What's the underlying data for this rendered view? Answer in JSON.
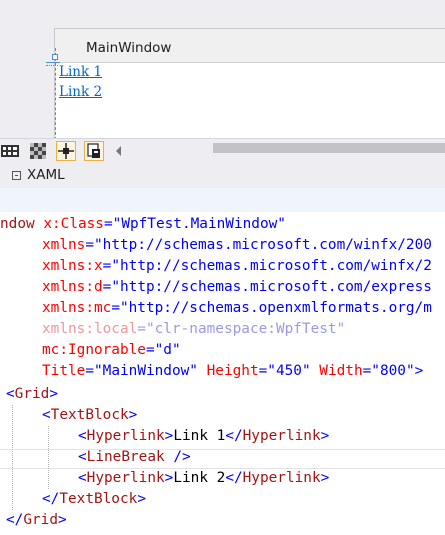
{
  "designer": {
    "window_title": "MainWindow",
    "links": [
      "Link 1",
      "Link 2"
    ]
  },
  "toolbar": {
    "icons": [
      "grid-icon",
      "checker-icon",
      "snap-icon",
      "artboard-icon"
    ]
  },
  "tab": {
    "label": "XAML"
  },
  "code": {
    "line1": {
      "pre": "ndow ",
      "a1": "x:Class",
      "v1": "\"WpfTest.MainWindow\""
    },
    "line2": {
      "a": "xmlns",
      "v": "\"http://schemas.microsoft.com/winfx/200"
    },
    "line3": {
      "a": "xmlns:x",
      "v": "\"http://schemas.microsoft.com/winfx/2"
    },
    "line4": {
      "a": "xmlns:d",
      "v": "\"http://schemas.microsoft.com/express"
    },
    "line5": {
      "a": "xmlns:mc",
      "v": "\"http://schemas.openxmlformats.org/m"
    },
    "line6": {
      "a": "xmlns:local",
      "v": "\"clr-namespace:WpfTest\""
    },
    "line7": {
      "a": "mc:Ignorable",
      "v": "\"d\""
    },
    "line8": {
      "a1": "Title",
      "v1": "\"MainWindow\"",
      "a2": "Height",
      "v2": "\"450\"",
      "a3": "Width",
      "v3": "\"800\"",
      "end": ">"
    },
    "grid_open": "Grid",
    "textblock_open": "TextBlock",
    "hyperlink": "Hyperlink",
    "link1": "Link 1",
    "linebreak": "LineBreak",
    "link2": "Link 2",
    "textblock_close": "TextBlock",
    "grid_close": "Grid"
  }
}
